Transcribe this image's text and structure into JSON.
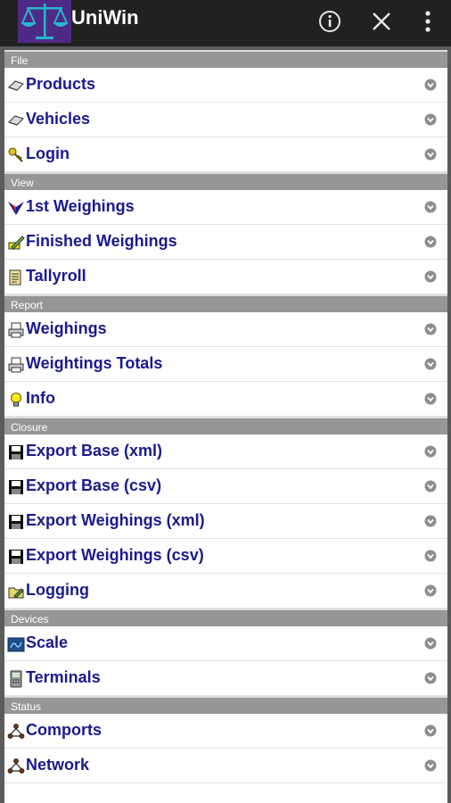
{
  "appbar": {
    "title": "UniWin",
    "actions": [
      {
        "icon": "info-icon"
      },
      {
        "icon": "close-icon"
      },
      {
        "icon": "more-vert-icon"
      }
    ]
  },
  "sections": [
    {
      "header": "File",
      "items": [
        {
          "label": "Products",
          "icon": "eraser-icon"
        },
        {
          "label": "Vehicles",
          "icon": "eraser-icon"
        },
        {
          "label": "Login",
          "icon": "key-icon"
        }
      ]
    },
    {
      "header": "View",
      "items": [
        {
          "label": "1st Weighings",
          "icon": "v-arrow-icon"
        },
        {
          "label": "Finished Weighings",
          "icon": "pencil-icon"
        },
        {
          "label": "Tallyroll",
          "icon": "document-icon"
        }
      ]
    },
    {
      "header": "Report",
      "items": [
        {
          "label": "Weighings",
          "icon": "printer-icon"
        },
        {
          "label": "Weightings Totals",
          "icon": "printer-icon"
        },
        {
          "label": "Info",
          "icon": "lightbulb-icon"
        }
      ]
    },
    {
      "header": "Closure",
      "items": [
        {
          "label": "Export Base (xml)",
          "icon": "floppy-icon"
        },
        {
          "label": "Export Base (csv)",
          "icon": "floppy-icon"
        },
        {
          "label": "Export Weighings (xml)",
          "icon": "floppy-icon"
        },
        {
          "label": "Export Weighings (csv)",
          "icon": "floppy-icon"
        },
        {
          "label": "Logging",
          "icon": "folder-pencil-icon"
        }
      ]
    },
    {
      "header": "Devices",
      "items": [
        {
          "label": "Scale",
          "icon": "scale-icon"
        },
        {
          "label": "Terminals",
          "icon": "terminal-icon"
        }
      ]
    },
    {
      "header": "Status",
      "items": [
        {
          "label": "Comports",
          "icon": "network-icon"
        },
        {
          "label": "Network",
          "icon": "network-icon"
        }
      ]
    }
  ]
}
